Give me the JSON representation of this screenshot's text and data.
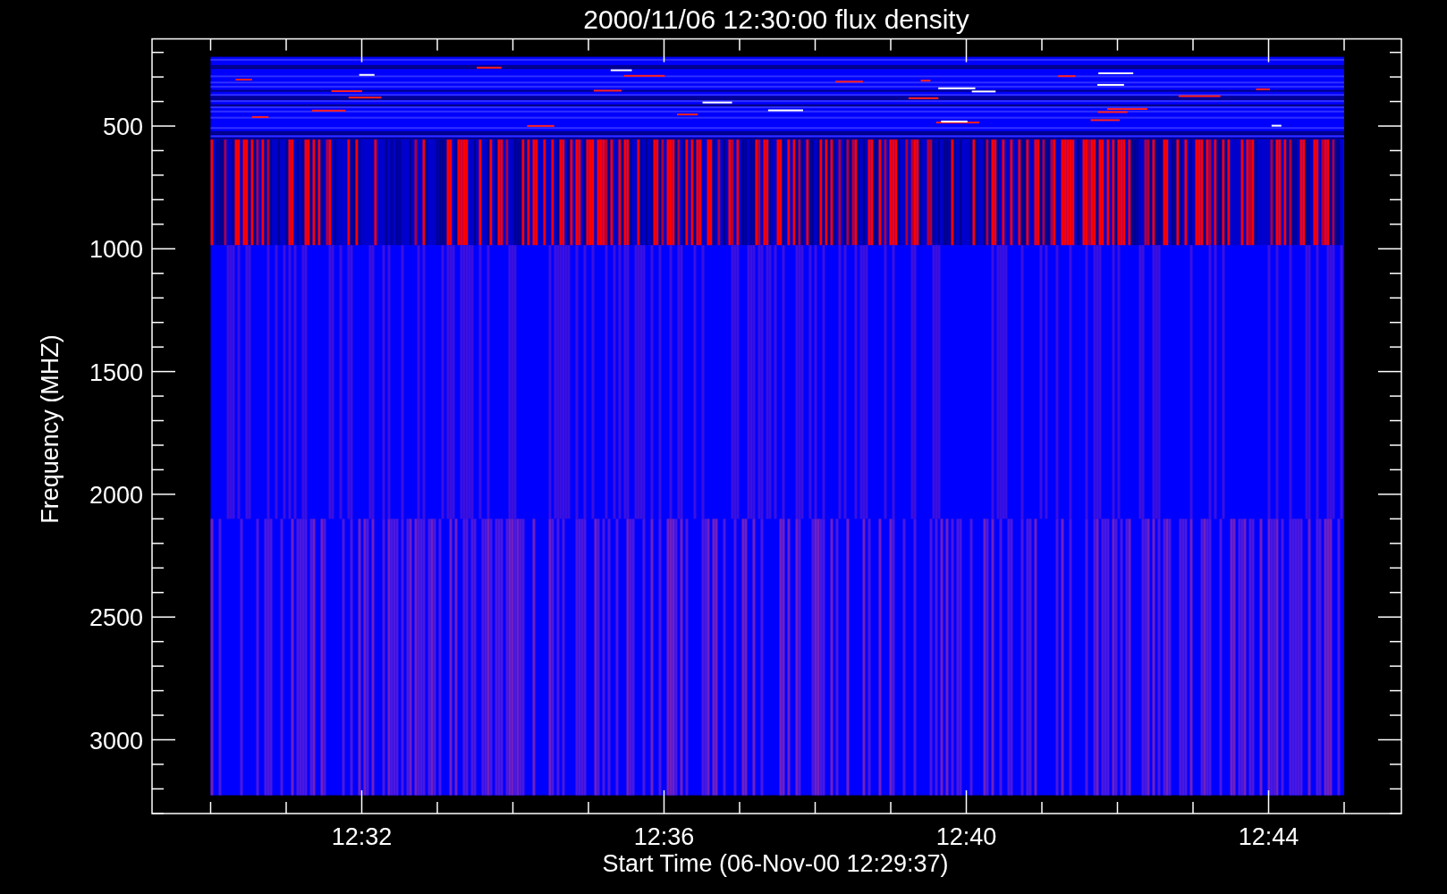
{
  "plot": {
    "title": "2000/11/06 12:30:00 flux density",
    "x_axis": {
      "label": "Start Time (06-Nov-00 12:29:37)",
      "ticks": [
        "12:32",
        "12:36",
        "12:40",
        "12:44"
      ]
    },
    "y_axis": {
      "label": "Frequency (MHZ)",
      "ticks": [
        "500",
        "1000",
        "1500",
        "2000",
        "2500",
        "3000"
      ]
    }
  }
}
